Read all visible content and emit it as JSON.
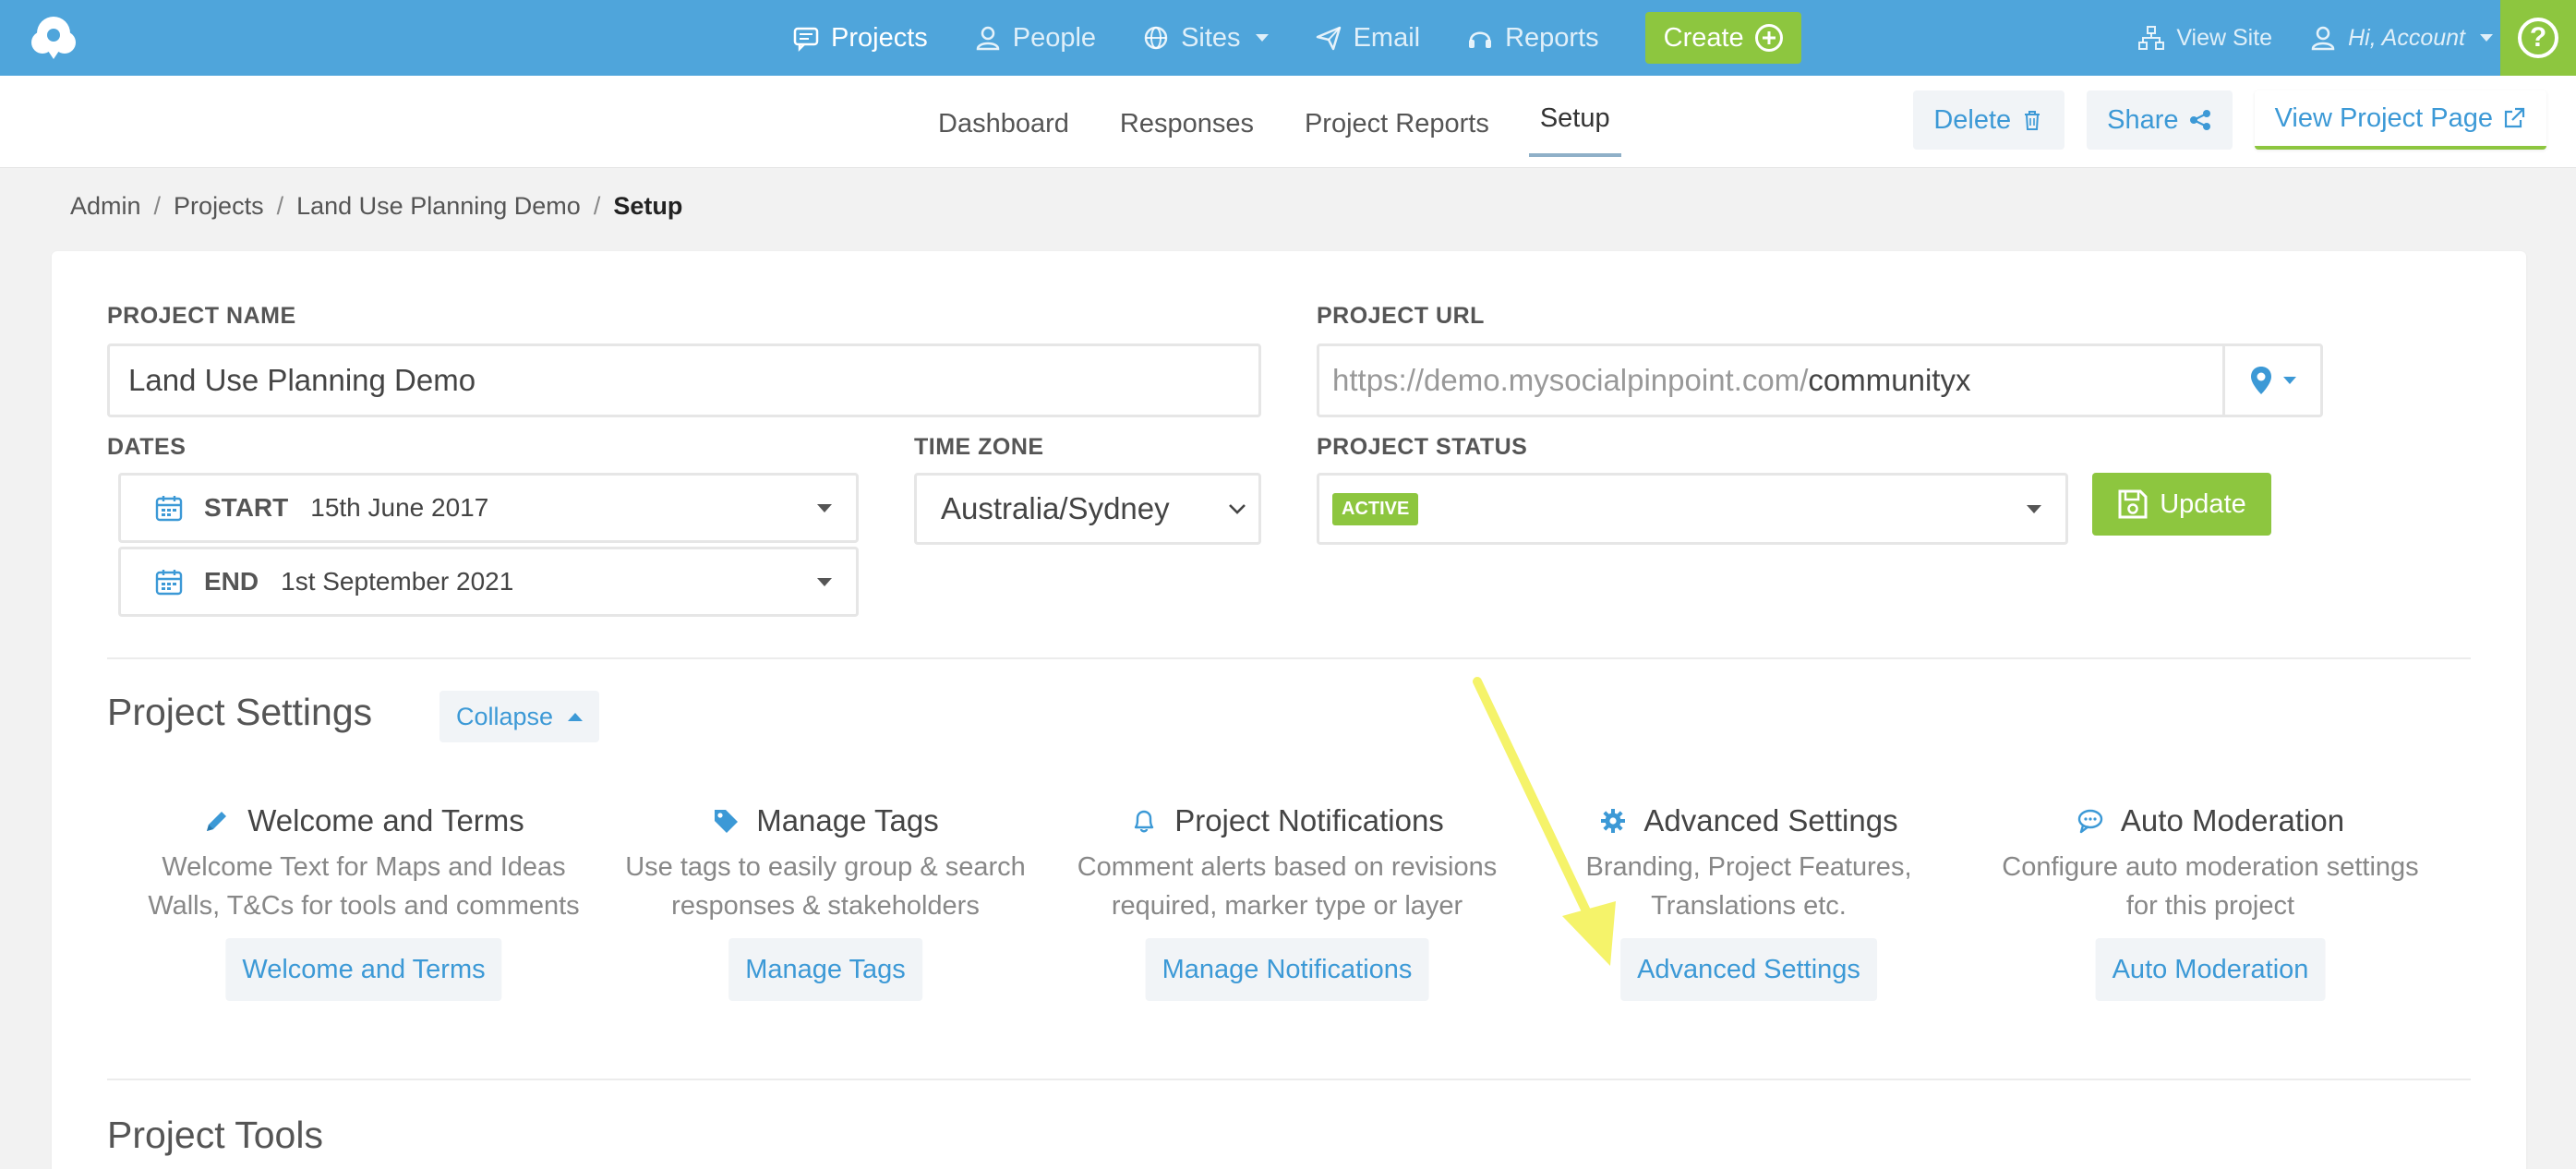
{
  "topnav": {
    "items": [
      {
        "label": "Projects",
        "icon": "chat-icon"
      },
      {
        "label": "People",
        "icon": "person-icon"
      },
      {
        "label": "Sites",
        "icon": "globe-icon"
      },
      {
        "label": "Email",
        "icon": "send-icon"
      },
      {
        "label": "Reports",
        "icon": "headset-icon"
      }
    ],
    "create_label": "Create",
    "view_site_label": "View Site",
    "account_label": "Hi, Account",
    "help_label": "?"
  },
  "subnav": {
    "tabs": [
      "Dashboard",
      "Responses",
      "Project Reports",
      "Setup"
    ],
    "active_tab": "Setup",
    "delete_label": "Delete",
    "share_label": "Share",
    "view_project_label": "View Project Page"
  },
  "breadcrumb": [
    "Admin",
    "Projects",
    "Land Use Planning Demo",
    "Setup"
  ],
  "form": {
    "project_name_label": "PROJECT NAME",
    "project_name_value": "Land Use Planning Demo",
    "project_url_label": "PROJECT URL",
    "project_url_prefix": "https://demo.mysocialpinpoint.com/",
    "project_url_slug": "communityx",
    "dates_label": "DATES",
    "start_label": "START",
    "start_value": "15th June 2017",
    "end_label": "END",
    "end_value": "1st September 2021",
    "timezone_label": "TIME ZONE",
    "timezone_value": "Australia/Sydney",
    "status_label": "PROJECT STATUS",
    "status_value": "ACTIVE",
    "update_label": "Update"
  },
  "project_settings": {
    "title": "Project Settings",
    "collapse_label": "Collapse",
    "items": [
      {
        "title": "Welcome and Terms",
        "desc1": "Welcome Text for Maps and Ideas",
        "desc2": "Walls, T&Cs for tools and comments",
        "button": "Welcome and Terms",
        "icon": "pencil-icon"
      },
      {
        "title": "Manage Tags",
        "desc1": "Use tags to easily group & search",
        "desc2": "responses & stakeholders",
        "button": "Manage Tags",
        "icon": "tag-icon"
      },
      {
        "title": "Project Notifications",
        "desc1": "Comment alerts based on revisions",
        "desc2": "required, marker type or layer",
        "button": "Manage Notifications",
        "icon": "bell-icon"
      },
      {
        "title": "Advanced Settings",
        "desc1": "Branding, Project Features,",
        "desc2": "Translations etc.",
        "button": "Advanced Settings",
        "icon": "gear-icon"
      },
      {
        "title": "Auto Moderation",
        "desc1": "Configure auto moderation settings",
        "desc2": "for this project",
        "button": "Auto Moderation",
        "icon": "speech-bubble-icon"
      }
    ]
  },
  "project_tools": {
    "title": "Project Tools"
  },
  "colors": {
    "nav_blue": "#4fa5db",
    "accent_green": "#8dc63f",
    "link_blue": "#3c99d6",
    "annotation_yellow": "#f5f36a"
  }
}
